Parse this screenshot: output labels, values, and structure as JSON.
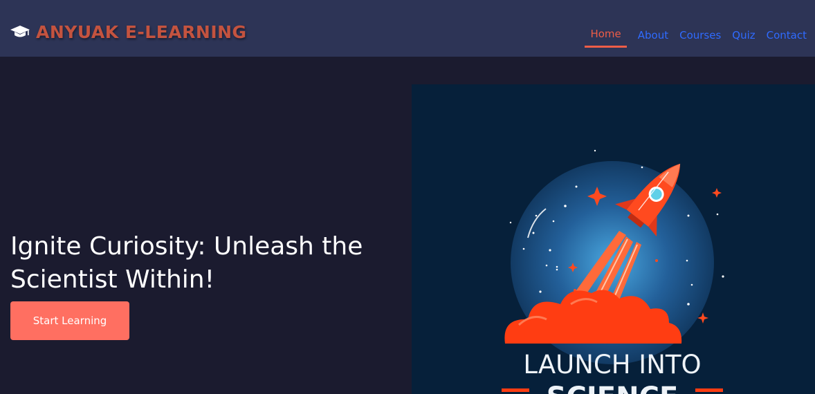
{
  "brand": {
    "icon": "graduation-cap-icon",
    "name": "ANYUAK E-LEARNING"
  },
  "nav": {
    "items": [
      {
        "label": "Home",
        "active": true
      },
      {
        "label": "About",
        "active": false
      },
      {
        "label": "Courses",
        "active": false
      },
      {
        "label": "Quiz",
        "active": false
      },
      {
        "label": "Contact",
        "active": false
      }
    ]
  },
  "hero": {
    "title": "Ignite Curiosity: Unleash the Scientist Within!",
    "cta_label": "Start Learning",
    "image": {
      "line1": "LAUNCH INTO",
      "line2": "SCIENCE"
    }
  },
  "colors": {
    "navbar_bg": "#2d3456",
    "page_bg": "#1b1b2f",
    "brand": "#c4533f",
    "nav_link": "#2f6bff",
    "nav_active": "#ee5d47",
    "cta_bg": "#ff6f61"
  }
}
